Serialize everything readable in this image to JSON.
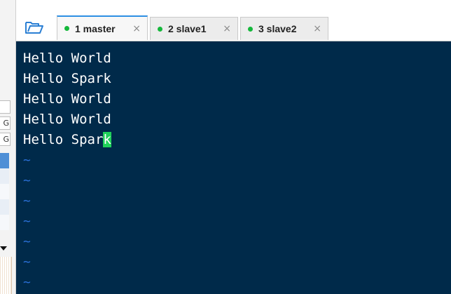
{
  "left_panel": {
    "boxes": [
      "G",
      "G"
    ]
  },
  "tabs": [
    {
      "label": "1 master",
      "active": true,
      "status_color": "#15b83b"
    },
    {
      "label": "2 slave1",
      "active": false,
      "status_color": "#15b83b"
    },
    {
      "label": "3 slave2",
      "active": false,
      "status_color": "#15b83b"
    }
  ],
  "close_glyph": "×",
  "terminal": {
    "lines": [
      {
        "text": "Hello World"
      },
      {
        "text": "Hello Spark"
      },
      {
        "text": "Hello World"
      },
      {
        "text": "Hello World"
      },
      {
        "text": "Hello Spar",
        "cursor_char": "k"
      }
    ],
    "empty_marker": "~",
    "empty_line_count": 7,
    "colors": {
      "background": "#002a4a",
      "text": "#ffffff",
      "cursor": "#1fd15a",
      "tilde": "#2a6fd6"
    }
  }
}
